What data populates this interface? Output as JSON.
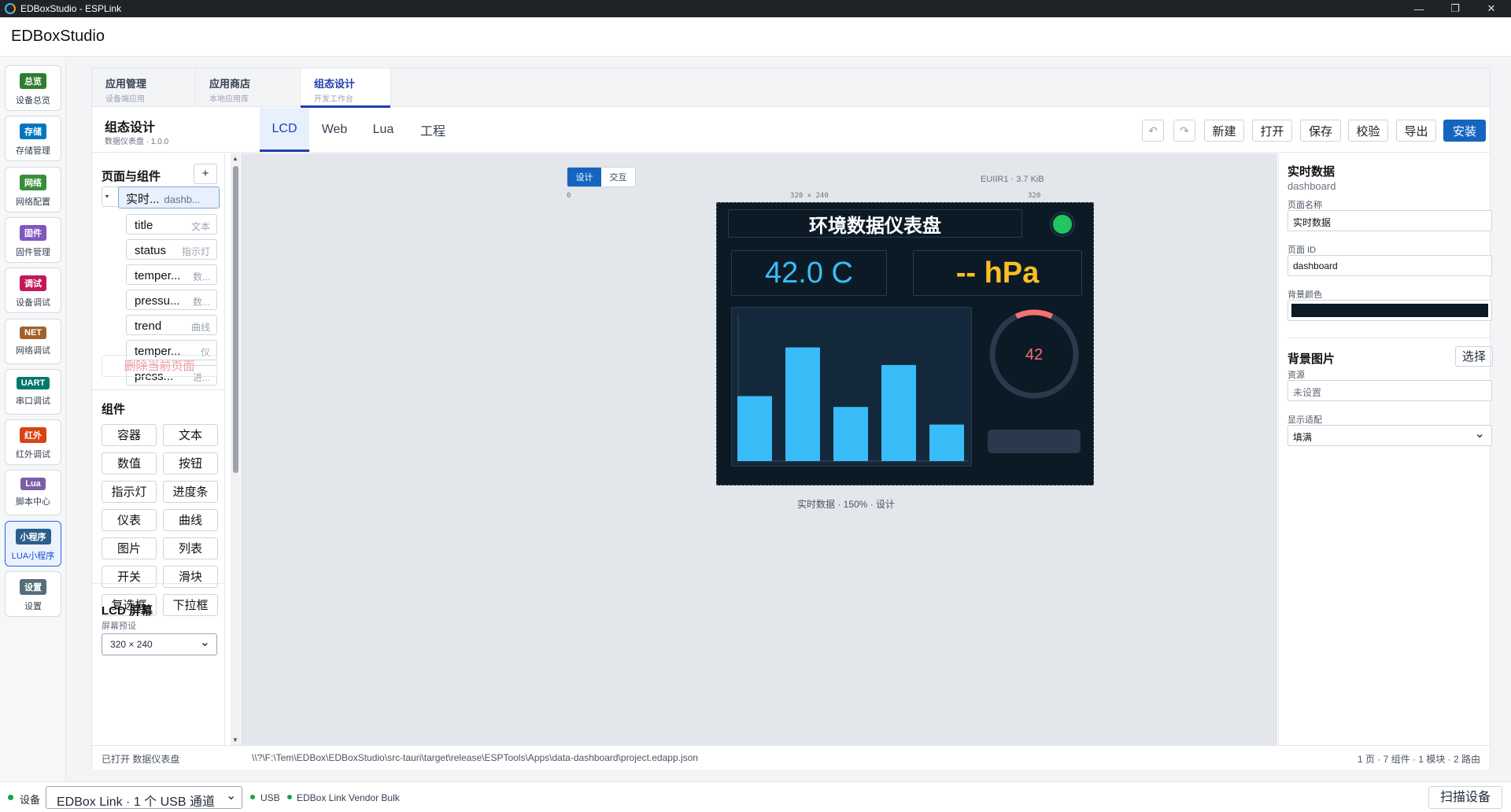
{
  "window": {
    "title": "EDBoxStudio - ESPLink",
    "minimize": "—",
    "maximize": "❐",
    "close": "✕"
  },
  "app": {
    "name": "EDBoxStudio"
  },
  "nav": [
    {
      "badge": "总览",
      "label": "设备总览",
      "color": "#2e7d32"
    },
    {
      "badge": "存储",
      "label": "存储管理",
      "color": "#0277bd"
    },
    {
      "badge": "网络",
      "label": "网络配置",
      "color": "#388e3c"
    },
    {
      "badge": "固件",
      "label": "固件管理",
      "color": "#7e57c2"
    },
    {
      "badge": "调试",
      "label": "设备调试",
      "color": "#c2185b"
    },
    {
      "badge": "NET",
      "label": "网络调试",
      "color": "#a1612b"
    },
    {
      "badge": "UART",
      "label": "串口调试",
      "color": "#00796b"
    },
    {
      "badge": "红外",
      "label": "红外调试",
      "color": "#d84315"
    },
    {
      "badge": "Lua",
      "label": "脚本中心",
      "color": "#7b5ea7"
    },
    {
      "badge": "小程序",
      "label": "LUA小程序",
      "color": "#2c5f8a"
    },
    {
      "badge": "设置",
      "label": "设置",
      "color": "#546e7a"
    }
  ],
  "tabs": [
    {
      "title": "应用管理",
      "sub": "设备端应用"
    },
    {
      "title": "应用商店",
      "sub": "本地应用库"
    },
    {
      "title": "组态设计",
      "sub": "开发工作台"
    }
  ],
  "header": {
    "title": "组态设计",
    "sub": "数据仪表盘 · 1.0.0"
  },
  "modetabs": [
    "LCD",
    "Web",
    "Lua",
    "工程"
  ],
  "toolbar": {
    "undo": "↶",
    "redo": "↷",
    "new": "新建",
    "open": "打开",
    "save": "保存",
    "check": "校验",
    "export": "导出",
    "install": "安装"
  },
  "pages": {
    "heading": "页面与组件",
    "add": "+",
    "root": {
      "label": "实时...",
      "kind": "dashb...",
      "toggle": "▾"
    },
    "nodes": [
      {
        "label": "title",
        "kind": "文本"
      },
      {
        "label": "status",
        "kind": "指示灯"
      },
      {
        "label": "temper...",
        "kind": "数..."
      },
      {
        "label": "pressu...",
        "kind": "数..."
      },
      {
        "label": "trend",
        "kind": "曲线"
      },
      {
        "label": "temper...",
        "kind": "仪"
      },
      {
        "label": "press...",
        "kind": "进..."
      }
    ],
    "delete": "删除当前页面"
  },
  "components": {
    "heading": "组件",
    "items": [
      "容器",
      "文本",
      "数值",
      "按钮",
      "指示灯",
      "进度条",
      "仪表",
      "曲线",
      "图片",
      "列表",
      "开关",
      "滑块",
      "复选框",
      "下拉框"
    ]
  },
  "lcd": {
    "heading": "LCD 屏幕",
    "preset_label": "屏幕预设",
    "preset": "320 × 240"
  },
  "canvas": {
    "mode_design": "设计",
    "mode_interact": "交互",
    "size": "320 × 240",
    "ruler_start": "0",
    "ruler_end": "320",
    "encoding": "EUIIR1 · 3.7 KiB",
    "caption": "实时数据 · 150% · 设计"
  },
  "screen": {
    "title": "环境数据仪表盘",
    "temperature": "42.0 C",
    "pressure": "-- hPa",
    "gauge_value": "42",
    "gauge_fraction": 0.14,
    "status_color": "#22c55e",
    "temp_color": "#38bdf8",
    "pressure_color": "#fbbf24",
    "bar_color": "#38bdf8",
    "gauge_color": "#f87171",
    "bars": [
      0.48,
      0.84,
      0.4,
      0.71,
      0.27
    ]
  },
  "props": {
    "title": "实时数据",
    "subtitle": "dashboard",
    "name_label": "页面名称",
    "name": "实时数据",
    "id_label": "页面 ID",
    "id": "dashboard",
    "bg_label": "背景颜色",
    "bg_color": "#0c1a26",
    "image_heading": "背景图片",
    "choose": "选择",
    "asset_label": "资源",
    "asset_placeholder": "未设置",
    "fit_label": "显示适配",
    "fit": "填满"
  },
  "footer": {
    "opened": "已打开 数据仪表盘",
    "path": "\\\\?\\F:\\Tem\\EDBox\\EDBoxStudio\\src-tauri\\target\\release\\ESPTools\\Apps\\data-dashboard\\project.edapp.json",
    "stats": "1 页 · 7 组件 · 1 模块 · 2 路由"
  },
  "status": {
    "device_label": "设备",
    "device": "EDBox Link · 1 个 USB 通道",
    "usb": "USB",
    "vendor": "EDBox Link Vendor Bulk",
    "scan": "扫描设备"
  }
}
